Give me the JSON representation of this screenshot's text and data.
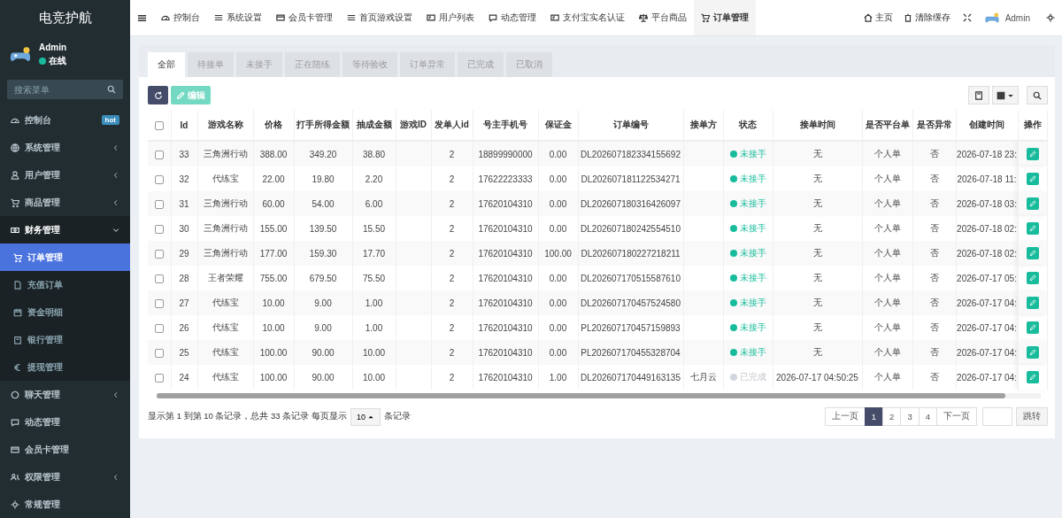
{
  "sidebar": {
    "title": "电竞护航",
    "user": {
      "name": "Admin",
      "status": "在线"
    },
    "search": {
      "placeholder": "搜索菜单"
    },
    "items": [
      {
        "label": "控制台",
        "badge": "hot",
        "expandable": false,
        "expanded": false,
        "selected": false
      },
      {
        "label": "系统管理",
        "expandable": true,
        "expanded": false,
        "selected": false
      },
      {
        "label": "用户管理",
        "expandable": true,
        "expanded": false,
        "selected": false
      },
      {
        "label": "商品管理",
        "expandable": true,
        "expanded": false,
        "selected": false
      },
      {
        "label": "财务管理",
        "expandable": true,
        "expanded": true,
        "selected": false,
        "children": [
          {
            "label": "订单管理",
            "selected": true
          },
          {
            "label": "充值订单",
            "selected": false
          },
          {
            "label": "资金明细",
            "selected": false
          },
          {
            "label": "银行管理",
            "selected": false
          },
          {
            "label": "提现管理",
            "selected": false
          }
        ]
      },
      {
        "label": "聊天管理",
        "expandable": true,
        "expanded": false,
        "selected": false
      },
      {
        "label": "动态管理",
        "expandable": false,
        "expanded": false,
        "selected": false
      },
      {
        "label": "会员卡管理",
        "expandable": false,
        "expanded": false,
        "selected": false
      },
      {
        "label": "权限管理",
        "expandable": true,
        "expanded": false,
        "selected": false
      },
      {
        "label": "常规管理",
        "expandable": false,
        "expanded": false,
        "selected": false
      }
    ]
  },
  "top_nav": {
    "tabs": [
      {
        "label": "控制台",
        "selected": false
      },
      {
        "label": "系统设置",
        "selected": false
      },
      {
        "label": "会员卡管理",
        "selected": false
      },
      {
        "label": "首页游戏设置",
        "selected": false
      },
      {
        "label": "用户列表",
        "selected": false
      },
      {
        "label": "动态管理",
        "selected": false
      },
      {
        "label": "支付宝实名认证",
        "selected": false
      },
      {
        "label": "平台商品",
        "selected": false
      },
      {
        "label": "订单管理",
        "selected": true
      }
    ],
    "links": [
      "主页",
      "清除缓存"
    ],
    "user": "Admin"
  },
  "filter_tabs": [
    {
      "label": "全部",
      "selected": true
    },
    {
      "label": "待接单",
      "selected": false
    },
    {
      "label": "未接手",
      "selected": false
    },
    {
      "label": "正在陪练",
      "selected": false
    },
    {
      "label": "等待验收",
      "selected": false
    },
    {
      "label": "订单异常",
      "selected": false
    },
    {
      "label": "已完成",
      "selected": false
    },
    {
      "label": "已取消",
      "selected": false
    }
  ],
  "toolbar": {
    "edit_button": "编辑"
  },
  "table": {
    "header_checked": false,
    "columns": [
      "Id",
      "游戏名称",
      "价格",
      "打手所得金额",
      "抽成金额",
      "游戏ID",
      "发单人id",
      "号主手机号",
      "保证金",
      "订单编号",
      "接单方",
      "状态",
      "接单时间",
      "是否平台单",
      "是否异常",
      "创建时间",
      "操作"
    ],
    "rows": [
      {
        "checked": false,
        "id": "33",
        "game": "三角洲行动",
        "price": "388.00",
        "earn": "349.20",
        "commission": "38.80",
        "sender_id": "2",
        "phone": "18899990000",
        "deposit": "0.00",
        "order_no": "DL202607182334155692",
        "status": {
          "text": "未接手",
          "kind": "pending"
        },
        "take_time": "无",
        "platform": "个人单",
        "abnormal": "否",
        "created": "2026-07-18 23:"
      },
      {
        "checked": false,
        "id": "32",
        "game": "代练宝",
        "price": "22.00",
        "earn": "19.80",
        "commission": "2.20",
        "sender_id": "2",
        "phone": "17622223333",
        "deposit": "0.00",
        "order_no": "DL202607181122534271",
        "status": {
          "text": "未接手",
          "kind": "pending"
        },
        "take_time": "无",
        "platform": "个人单",
        "abnormal": "否",
        "created": "2026-07-18 11:"
      },
      {
        "checked": false,
        "id": "31",
        "game": "三角洲行动",
        "price": "60.00",
        "earn": "54.00",
        "commission": "6.00",
        "sender_id": "2",
        "phone": "17620104310",
        "deposit": "0.00",
        "order_no": "DL202607180316426097",
        "status": {
          "text": "未接手",
          "kind": "pending"
        },
        "take_time": "无",
        "platform": "个人单",
        "abnormal": "否",
        "created": "2026-07-18 03:"
      },
      {
        "checked": false,
        "id": "30",
        "game": "三角洲行动",
        "price": "155.00",
        "earn": "139.50",
        "commission": "15.50",
        "sender_id": "2",
        "phone": "17620104310",
        "deposit": "0.00",
        "order_no": "DL202607180242554510",
        "status": {
          "text": "未接手",
          "kind": "pending"
        },
        "take_time": "无",
        "platform": "个人单",
        "abnormal": "否",
        "created": "2026-07-18 02:"
      },
      {
        "checked": false,
        "id": "29",
        "game": "三角洲行动",
        "price": "177.00",
        "earn": "159.30",
        "commission": "17.70",
        "sender_id": "2",
        "phone": "17620104310",
        "deposit": "100.00",
        "order_no": "DL202607180227218211",
        "status": {
          "text": "未接手",
          "kind": "pending"
        },
        "take_time": "无",
        "platform": "个人单",
        "abnormal": "否",
        "created": "2026-07-18 02:"
      },
      {
        "checked": false,
        "id": "28",
        "game": "王者荣耀",
        "price": "755.00",
        "earn": "679.50",
        "commission": "75.50",
        "sender_id": "2",
        "phone": "17620104310",
        "deposit": "0.00",
        "order_no": "DL202607170515587610",
        "status": {
          "text": "未接手",
          "kind": "pending"
        },
        "take_time": "无",
        "platform": "个人单",
        "abnormal": "否",
        "created": "2026-07-17 05:"
      },
      {
        "checked": false,
        "id": "27",
        "game": "代练宝",
        "price": "10.00",
        "earn": "9.00",
        "commission": "1.00",
        "sender_id": "2",
        "phone": "17620104310",
        "deposit": "0.00",
        "order_no": "DL202607170457524580",
        "status": {
          "text": "未接手",
          "kind": "pending"
        },
        "take_time": "无",
        "platform": "个人单",
        "abnormal": "否",
        "created": "2026-07-17 04:"
      },
      {
        "checked": false,
        "id": "26",
        "game": "代练宝",
        "price": "10.00",
        "earn": "9.00",
        "commission": "1.00",
        "sender_id": "2",
        "phone": "17620104310",
        "deposit": "0.00",
        "order_no": "PL202607170457159893",
        "status": {
          "text": "未接手",
          "kind": "pending"
        },
        "take_time": "无",
        "platform": "个人单",
        "abnormal": "否",
        "created": "2026-07-17 04:"
      },
      {
        "checked": false,
        "id": "25",
        "game": "代练宝",
        "price": "100.00",
        "earn": "90.00",
        "commission": "10.00",
        "sender_id": "2",
        "phone": "17620104310",
        "deposit": "0.00",
        "order_no": "PL202607170455328704",
        "status": {
          "text": "未接手",
          "kind": "pending"
        },
        "take_time": "无",
        "platform": "个人单",
        "abnormal": "否",
        "created": "2026-07-17 04:"
      },
      {
        "checked": false,
        "id": "24",
        "game": "代练宝",
        "price": "100.00",
        "earn": "90.00",
        "commission": "10.00",
        "sender_id": "2",
        "phone": "17620104310",
        "deposit": "1.00",
        "order_no": "DL202607170449163135",
        "taker": "七月云",
        "status": {
          "text": "已完成",
          "kind": "done"
        },
        "take_time": "2026-07-17 04:50:25",
        "platform": "个人单",
        "abnormal": "否",
        "created": "2026-07-17 04:"
      }
    ]
  },
  "footer": {
    "summary": "显示第 1 到第 10 条记录，总共 33 条记录 每页显示",
    "page_size": "10",
    "suffix": "条记录",
    "pagination": {
      "prev": "上一页",
      "pages": [
        {
          "label": "1",
          "selected": true
        },
        {
          "label": "2",
          "selected": false
        },
        {
          "label": "3",
          "selected": false
        },
        {
          "label": "4",
          "selected": false
        }
      ],
      "next": "下一页",
      "go": "跳转"
    }
  }
}
